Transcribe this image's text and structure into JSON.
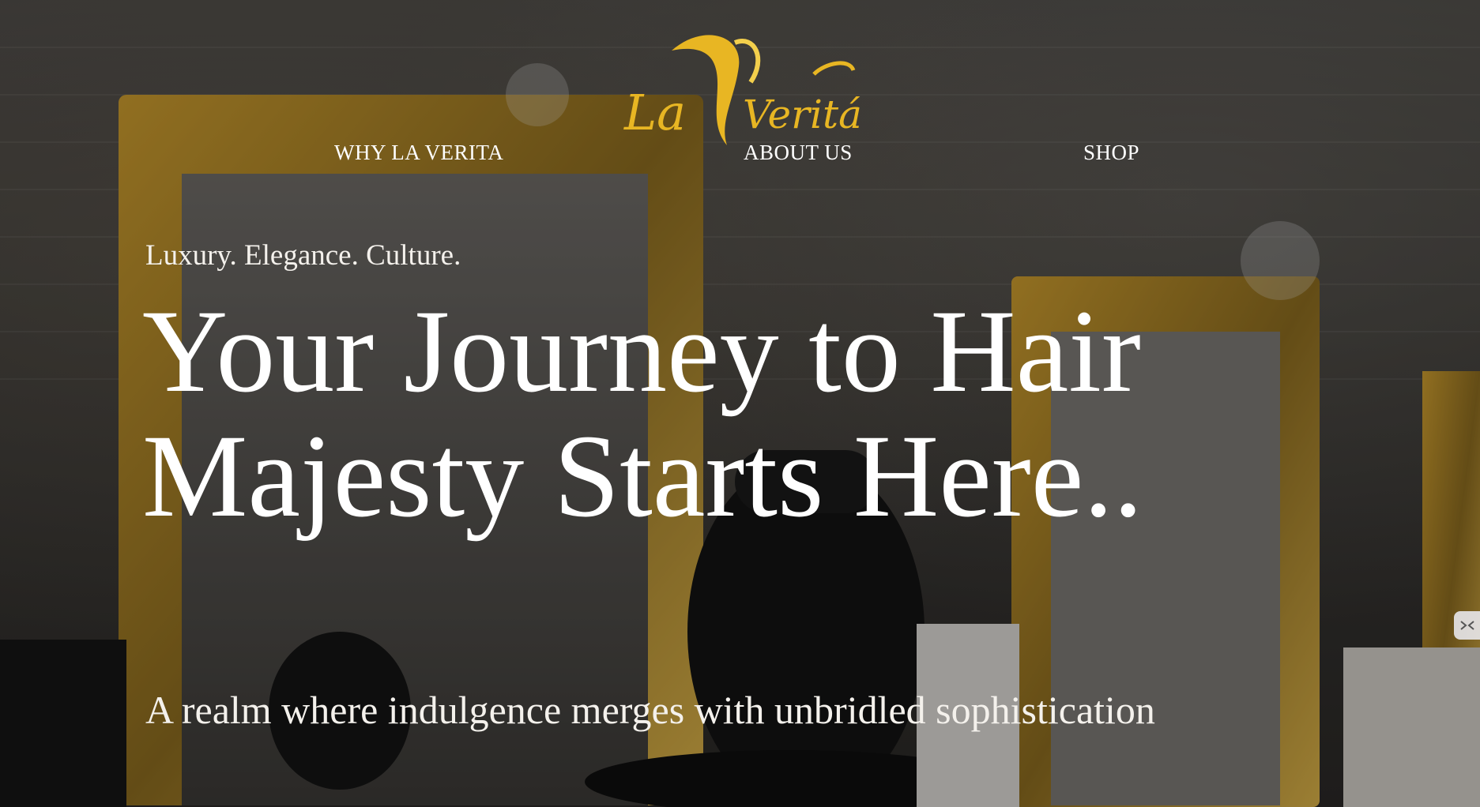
{
  "brand": {
    "logo_text_1": "La",
    "logo_text_2": "Veritá",
    "logo_color": "#e8b623"
  },
  "nav": {
    "items": [
      {
        "label": "WHY LA VERITA"
      },
      {
        "label": "ABOUT US"
      },
      {
        "label": "SHOP"
      }
    ]
  },
  "hero": {
    "tagline": "Luxury. Elegance. Culture.",
    "headline": "Your Journey to Hair Majesty Starts Here..",
    "subtitle": "A realm where indulgence merges with unbridled sophistication",
    "background": "salon interior with gold ornate mirrors and black barber chair"
  },
  "colors": {
    "text": "#ffffff",
    "accent_gold": "#d4a21b"
  },
  "widget": {
    "icon": "collapse-arrows-icon"
  }
}
